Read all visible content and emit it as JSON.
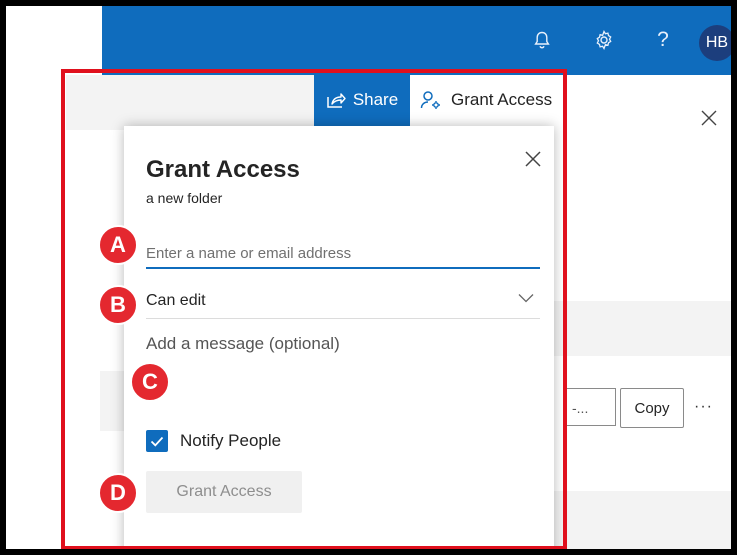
{
  "topbar": {
    "icons": [
      "bell-icon",
      "gear-icon",
      "help-icon"
    ],
    "help_glyph": "?",
    "avatar_initials": "HB",
    "color": "#0f6cbd"
  },
  "background": {
    "share_label": "Share",
    "grant_access_tab_label": "Grant Access",
    "link_text": "-...",
    "copy_label": "Copy",
    "more_label": "···"
  },
  "dialog": {
    "title": "Grant Access",
    "subtitle": "a new folder",
    "name_placeholder": "Enter a name or email address",
    "permission_value": "Can edit",
    "message_placeholder": "Add a message (optional)",
    "notify_label": "Notify People",
    "notify_checked": true,
    "grant_button_label": "Grant Access"
  },
  "annotations": {
    "markers": [
      "A",
      "B",
      "C",
      "D"
    ],
    "color": "#e0101d"
  }
}
